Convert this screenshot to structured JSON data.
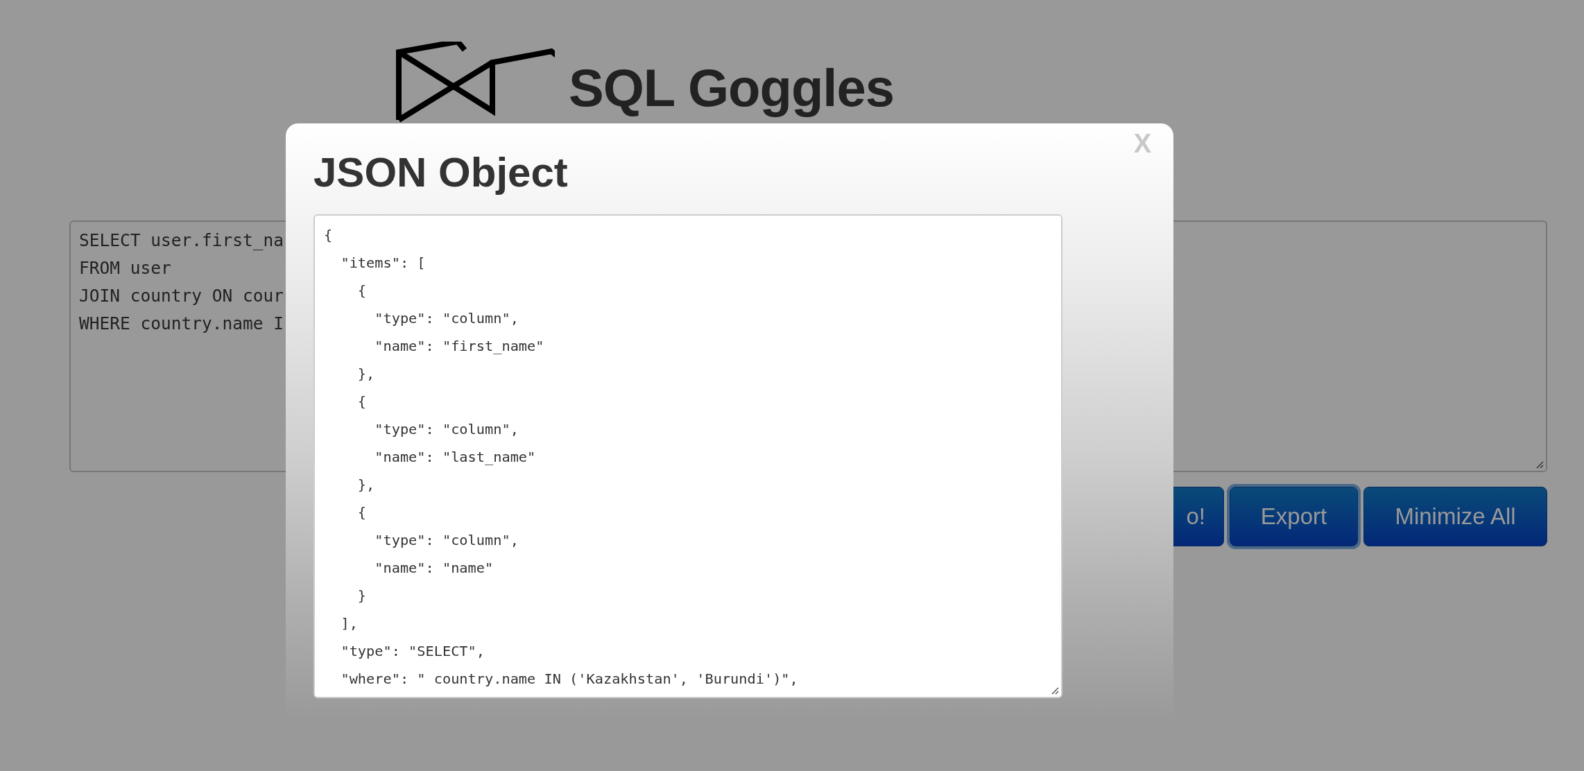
{
  "header": {
    "title": "SQL Goggles"
  },
  "query_field": {
    "lines": [
      "SELECT user.first_na",
      "FROM user",
      "JOIN country ON cour",
      "WHERE country.name I"
    ]
  },
  "buttons": [
    {
      "label": "o!",
      "focused": false
    },
    {
      "label": "Export",
      "focused": true
    },
    {
      "label": "Minimize All",
      "focused": false
    }
  ],
  "modal": {
    "title": "JSON Object",
    "close": "X",
    "json_field": {
      "value": "{\n  \"items\": [\n    {\n      \"type\": \"column\",\n      \"name\": \"first_name\"\n    },\n    {\n      \"type\": \"column\",\n      \"name\": \"last_name\"\n    },\n    {\n      \"type\": \"column\",\n      \"name\": \"name\"\n    }\n  ],\n  \"type\": \"SELECT\",\n  \"where\": \" country.name IN ('Kazakhstan', 'Burundi')\","
    }
  }
}
